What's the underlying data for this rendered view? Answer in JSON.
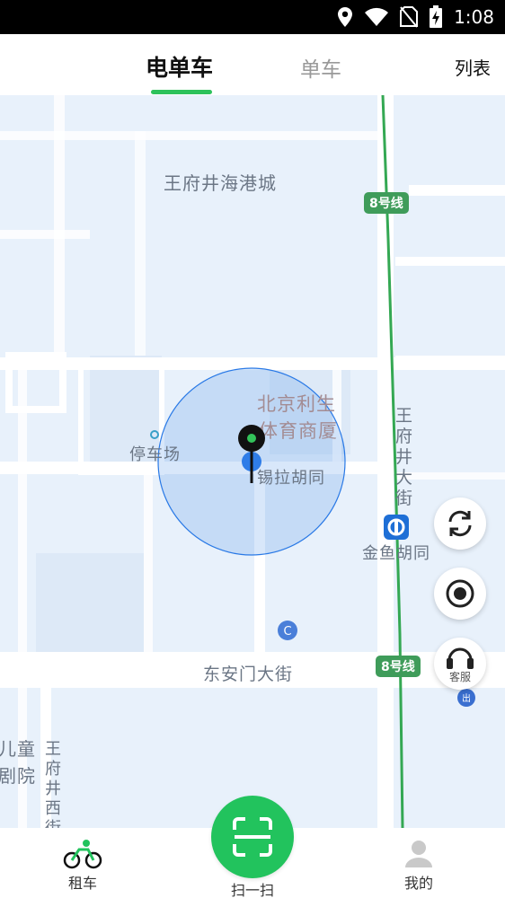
{
  "status_bar": {
    "time": "1:08"
  },
  "top_tabs": {
    "ebike": "电单车",
    "bike": "单车",
    "list": "列表"
  },
  "map": {
    "labels": {
      "wangfujing_mall": "王府井海港城",
      "line8_top": "8号线",
      "beijing_lisheng_1": "北京利生",
      "beijing_lisheng_2": "体育商厦",
      "parking": "停车场",
      "xila_hutong": "锡拉胡同",
      "wangfujing_street": "王府井大街",
      "jinyu_hutong": "金鱼胡同",
      "dongan_men": "东安门大街",
      "line8_bottom": "8号线",
      "children_1": "儿童",
      "children_2": "剧院",
      "wangfujing_west": "王府井西街"
    },
    "metro_color": "#3f9c5a",
    "route_color": "#34a853"
  },
  "fabs": {
    "service_label": "客服"
  },
  "bottom_nav": {
    "rent": "租车",
    "scan": "扫一扫",
    "mine": "我的"
  },
  "colors": {
    "accent": "#22c35d",
    "map_bg": "#e9f1fb",
    "pin_ring": "#2979e6"
  }
}
